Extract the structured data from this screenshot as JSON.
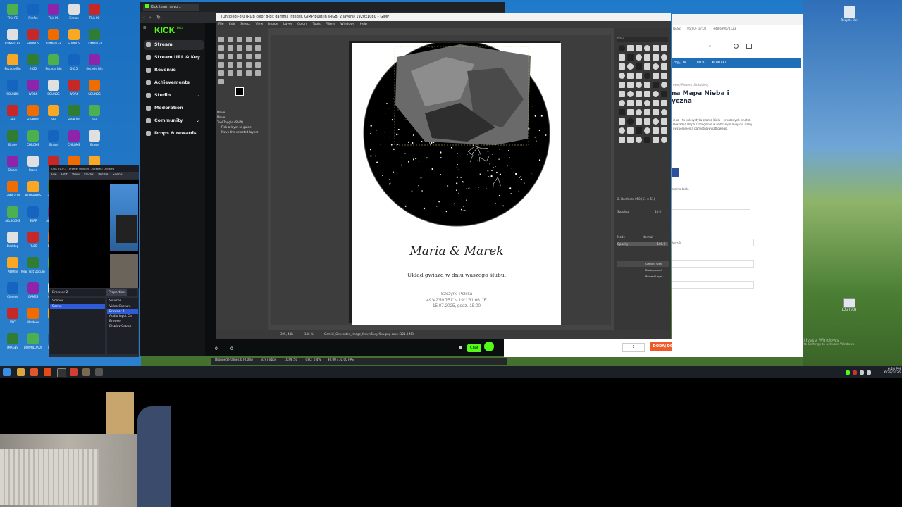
{
  "colors": {
    "kick_green": "#53fc18",
    "obs_blue": "#2e5bd8",
    "shop_blue": "#1e6fb8",
    "shop_orange": "#f05a28",
    "gimp_bg": "#454545"
  },
  "desktop": {
    "left_icons": [
      "This PC",
      "COMPUTER",
      "Recycle Bin",
      "SOUNDS",
      "obs",
      "Brave",
      "Steam",
      "GIMP 2.10",
      "ALL ICONS",
      "Desktop",
      "ADMIN",
      "Chrome",
      "VLC",
      "IMAGES",
      "Firefox",
      "SOUNDS",
      "2025",
      "WORK",
      "SUPPORT",
      "CHROME",
      "Brave",
      "PROGRAMS",
      "SUPP",
      "FILES",
      "New Text Document",
      "GAMES",
      "Windows",
      "DOWNLOADS"
    ],
    "right_icons": [
      {
        "label": "Recycle Bin",
        "icon": "recycle-bin-icon"
      },
      {
        "label": "LOGITECH",
        "icon": "monitor-icon"
      }
    ],
    "activate_windows": {
      "title": "Activate Windows",
      "subtitle": "Go to Settings to activate Windows."
    }
  },
  "taskbar": {
    "time": "6:28 PM",
    "date": "6/28/2026"
  },
  "kick": {
    "tab_title": "Kick team sayo...",
    "logo": "KICK",
    "logo_badge": "beta",
    "nav": [
      "Stream",
      "Stream URL & Key",
      "Revenue",
      "Achievements",
      "Studio",
      "Moderation",
      "Community",
      "Drops & rewards"
    ],
    "status": {
      "dropped": "Dropped Frames 0 (0.0%)",
      "bitrate": "8197 kbps",
      "time": "10:08:50",
      "cpu": "CPU: 0.4%",
      "fps": "30.00 / 30.00 FPS"
    },
    "bottom": {
      "viewers": "0",
      "likes": "0",
      "chat_button": "Chat"
    }
  },
  "obs": {
    "title": "OBS 31.0.3 - Profile: Untitled - Scenes: Untitled",
    "menu": [
      "File",
      "Edit",
      "View",
      "Docks",
      "Profile",
      "Scene Collection"
    ],
    "source_label": "Browser 2",
    "properties_button": "Properties",
    "scenes_header": "Scenes",
    "sources_header": "Sources",
    "scenes": [
      "Scene"
    ],
    "sources": [
      "Video Capture",
      "Browser 2",
      "Audio Input Ca",
      "Browser",
      "Display Captur"
    ]
  },
  "gimp": {
    "title": "[Untitled]-8.0 (RGB color 8-bit gamma integer, GIMP built-in sRGB, 2 layers) 1920x1080 – GIMP",
    "menu": [
      "File",
      "Edit",
      "Select",
      "View",
      "Image",
      "Layer",
      "Colors",
      "Tools",
      "Filters",
      "Windows",
      "Help"
    ],
    "tool_options": {
      "title": "Move",
      "mode": "Move:",
      "toggle": "Tool Toggle (Shift)",
      "opt1": "Pick a layer or guide",
      "opt2": "Move the selected layers"
    },
    "brushes_filter": "filter",
    "brush_name": "2. Hardness 050 (51 × 51)",
    "spacing_label": "Spacing",
    "spacing_value": "10.0",
    "layers": {
      "mode_label": "Mode",
      "mode_value": "Normal",
      "opacity_label": "Opacity",
      "opacity_value": "100.0",
      "items": [
        "Gemini_Gen",
        "Background",
        "Pasted Layer"
      ]
    },
    "status": {
      "coords": "305, 455",
      "unit": "px",
      "zoom": "146 %",
      "file": "Gemini_Generated_Image_fxxxyr5uxyr5xu.png copy (121.8 MB)"
    }
  },
  "poster": {
    "names": "Maria & Marek",
    "subtitle": "Układ gwiazd w dniu waszego ślubu.",
    "city": "Szczyrk, Polska",
    "coords": "49°42'59.751\"N 19°1'31.661\"E",
    "date": "15.07.2025, godz. 15:00"
  },
  "shop": {
    "contact_phone": "+48 699071123",
    "contact_hours": "05:00 - 17:00",
    "contact_email": "NASZ",
    "nav": [
      "ZDJĘCIA",
      "BLOG",
      "KONTAKT"
    ],
    "breadcrumb": "Prezent dla kobiety",
    "breadcrumb_prefix": "owe",
    "title": "na Mapa Nieba i yczna",
    "desc": "ieba – to kolorystyka czarno-biała – eroczonych wnętrz. Dokładna Mapa szczególnie w wybranym miejscu, daruj i wspomnienia pamiętna wyjątkowego.",
    "option_label": "czarno-biała",
    "input_text": "ka <3",
    "qty": "1",
    "add_to_cart": "DODAJ DO KOSZYKA"
  }
}
